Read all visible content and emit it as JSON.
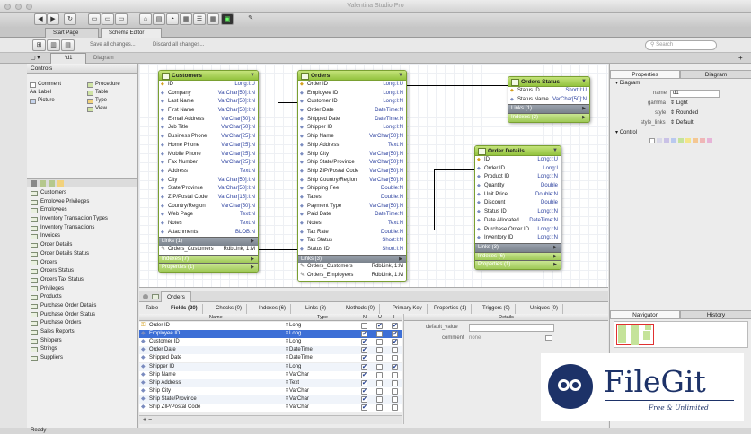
{
  "window_title": "Valentina Studio Pro",
  "doc_tabs": [
    "Start Page",
    "Schema Editor"
  ],
  "actions": {
    "save_all": "Save all changes...",
    "discard_all": "Discard all changes...",
    "search_placeholder": "Search"
  },
  "sub_tabs": {
    "d1": "*d1",
    "diagram": "Diagram"
  },
  "left_panel": {
    "controls_title": "Controls",
    "controls": [
      "Comment",
      "Procedure",
      "Label",
      "Table",
      "Picture",
      "Type",
      "View"
    ],
    "tables": [
      "Customers",
      "Employee Privileges",
      "Employees",
      "Inventory Transaction Types",
      "Inventory Transactions",
      "Invoices",
      "Order Details",
      "Order Details Status",
      "Orders",
      "Orders Status",
      "Orders Tax Status",
      "Privileges",
      "Products",
      "Purchase Order Details",
      "Purchase Order Status",
      "Purchase Orders",
      "Sales Reports",
      "Shippers",
      "Strings",
      "Suppliers"
    ]
  },
  "entities": {
    "customers": {
      "name": "Customers",
      "fields": [
        [
          "ID",
          "Long:I:U"
        ],
        [
          "Company",
          "VarChar[50]:I:N"
        ],
        [
          "Last Name",
          "VarChar[50]:I:N"
        ],
        [
          "First Name",
          "VarChar[50]:I:N"
        ],
        [
          "E-mail Address",
          "VarChar[50]:N"
        ],
        [
          "Job Title",
          "VarChar[50]:N"
        ],
        [
          "Business Phone",
          "VarChar[25]:N"
        ],
        [
          "Home Phone",
          "VarChar[25]:N"
        ],
        [
          "Mobile Phone",
          "VarChar[25]:N"
        ],
        [
          "Fax Number",
          "VarChar[25]:N"
        ],
        [
          "Address",
          "Text:N"
        ],
        [
          "City",
          "VarChar[50]:I:N"
        ],
        [
          "State/Province",
          "VarChar[50]:I:N"
        ],
        [
          "ZIP/Postal Code",
          "VarChar[15]:I:N"
        ],
        [
          "Country/Region",
          "VarChar[50]:N"
        ],
        [
          "Web Page",
          "Text:N"
        ],
        [
          "Notes",
          "Text:N"
        ],
        [
          "Attachments",
          "BLOB:N"
        ]
      ],
      "links_label": "Links (1)",
      "links": [
        [
          "Orders_Customers",
          "RdbLink, 1:M"
        ]
      ],
      "indexes_label": "Indexes (7)",
      "properties_label": "Properties (1)"
    },
    "orders": {
      "name": "Orders",
      "fields": [
        [
          "Order ID",
          "Long:I:U"
        ],
        [
          "Employee ID",
          "Long:I:N"
        ],
        [
          "Customer ID",
          "Long:I:N"
        ],
        [
          "Order Date",
          "DateTime:N"
        ],
        [
          "Shipped Date",
          "DateTime:N"
        ],
        [
          "Shipper ID",
          "Long:I:N"
        ],
        [
          "Ship Name",
          "VarChar[50]:N"
        ],
        [
          "Ship Address",
          "Text:N"
        ],
        [
          "Ship City",
          "VarChar[50]:N"
        ],
        [
          "Ship State/Province",
          "VarChar[50]:N"
        ],
        [
          "Ship ZIP/Postal Code",
          "VarChar[50]:N"
        ],
        [
          "Ship Country/Region",
          "VarChar[50]:N"
        ],
        [
          "Shipping Fee",
          "Double:N"
        ],
        [
          "Taxes",
          "Double:N"
        ],
        [
          "Payment Type",
          "VarChar[50]:N"
        ],
        [
          "Paid Date",
          "DateTime:N"
        ],
        [
          "Notes",
          "Text:N"
        ],
        [
          "Tax Rate",
          "Double:N"
        ],
        [
          "Tax Status",
          "Short:I:N"
        ],
        [
          "Status ID",
          "Short:I:N"
        ]
      ],
      "links_label": "Links (3)",
      "links": [
        [
          "Orders_Customers",
          "RdbLink, 1:M"
        ],
        [
          "Orders_Employees",
          "RdbLink, 1:M"
        ]
      ]
    },
    "orders_status": {
      "name": "Orders Status",
      "fields": [
        [
          "Status ID",
          "Short:I:U"
        ],
        [
          "Status Name",
          "VarChar[50]:N"
        ]
      ],
      "links_label": "Links (1)",
      "indexes_label": "Indexes (2)"
    },
    "order_details": {
      "name": "Order Details",
      "fields": [
        [
          "ID",
          "Long:I:U"
        ],
        [
          "Order ID",
          "Long:I"
        ],
        [
          "Product ID",
          "Long:I:N"
        ],
        [
          "Quantity",
          "Double"
        ],
        [
          "Unit Price",
          "Double:N"
        ],
        [
          "Discount",
          "Double"
        ],
        [
          "Status ID",
          "Long:I:N"
        ],
        [
          "Date Allocated",
          "DateTime:N"
        ],
        [
          "Purchase Order ID",
          "Long:I:N"
        ],
        [
          "Inventory ID",
          "Long:I:N"
        ]
      ],
      "links_label": "Links (3)",
      "indexes_label": "Indexes (6)",
      "properties_label": "Properties (1)"
    }
  },
  "bottom": {
    "title": "Orders",
    "tabs": [
      "Table",
      "Fields (20)",
      "Checks (0)",
      "Indexes (6)",
      "Links (8)",
      "Methods (0)",
      "Primary Key",
      "Properties (1)",
      "Triggers (0)",
      "Uniques (0)"
    ],
    "col_name": "Name",
    "col_type": "Type",
    "col_n": "N",
    "col_u": "U",
    "col_i": "I",
    "rows": [
      {
        "name": "Order ID",
        "type": "Long",
        "n": false,
        "u": true,
        "i": true
      },
      {
        "name": "Employee ID",
        "type": "Long",
        "n": true,
        "u": false,
        "i": true
      },
      {
        "name": "Customer ID",
        "type": "Long",
        "n": true,
        "u": false,
        "i": true
      },
      {
        "name": "Order Date",
        "type": "DateTime",
        "n": true,
        "u": false,
        "i": false
      },
      {
        "name": "Shipped Date",
        "type": "DateTime",
        "n": true,
        "u": false,
        "i": false
      },
      {
        "name": "Shipper ID",
        "type": "Long",
        "n": true,
        "u": false,
        "i": true
      },
      {
        "name": "Ship Name",
        "type": "VarChar",
        "n": true,
        "u": false,
        "i": false
      },
      {
        "name": "Ship Address",
        "type": "Text",
        "n": true,
        "u": false,
        "i": false
      },
      {
        "name": "Ship City",
        "type": "VarChar",
        "n": true,
        "u": false,
        "i": false
      },
      {
        "name": "Ship State/Province",
        "type": "VarChar",
        "n": true,
        "u": false,
        "i": false
      },
      {
        "name": "Ship ZIP/Postal Code",
        "type": "VarChar",
        "n": true,
        "u": false,
        "i": false
      }
    ],
    "details_title": "Details",
    "default_value_label": "default_value",
    "comment_label": "comment",
    "comment_value": "none"
  },
  "right_panel": {
    "tabs": [
      "Properties",
      "Diagram"
    ],
    "diagram_label": "Diagram",
    "name_label": "name",
    "name_value": "d1",
    "gamma_label": "gamma",
    "gamma_value": "Light",
    "style_label": "style",
    "style_value": "Rounded",
    "style_links_label": "style_links",
    "style_links_value": "Default",
    "control_label": "Control",
    "nav_tabs": [
      "Navigator",
      "History"
    ]
  },
  "status": "Ready",
  "watermark": {
    "brand": "FileGit",
    "tagline": "Free & Unlimited"
  }
}
